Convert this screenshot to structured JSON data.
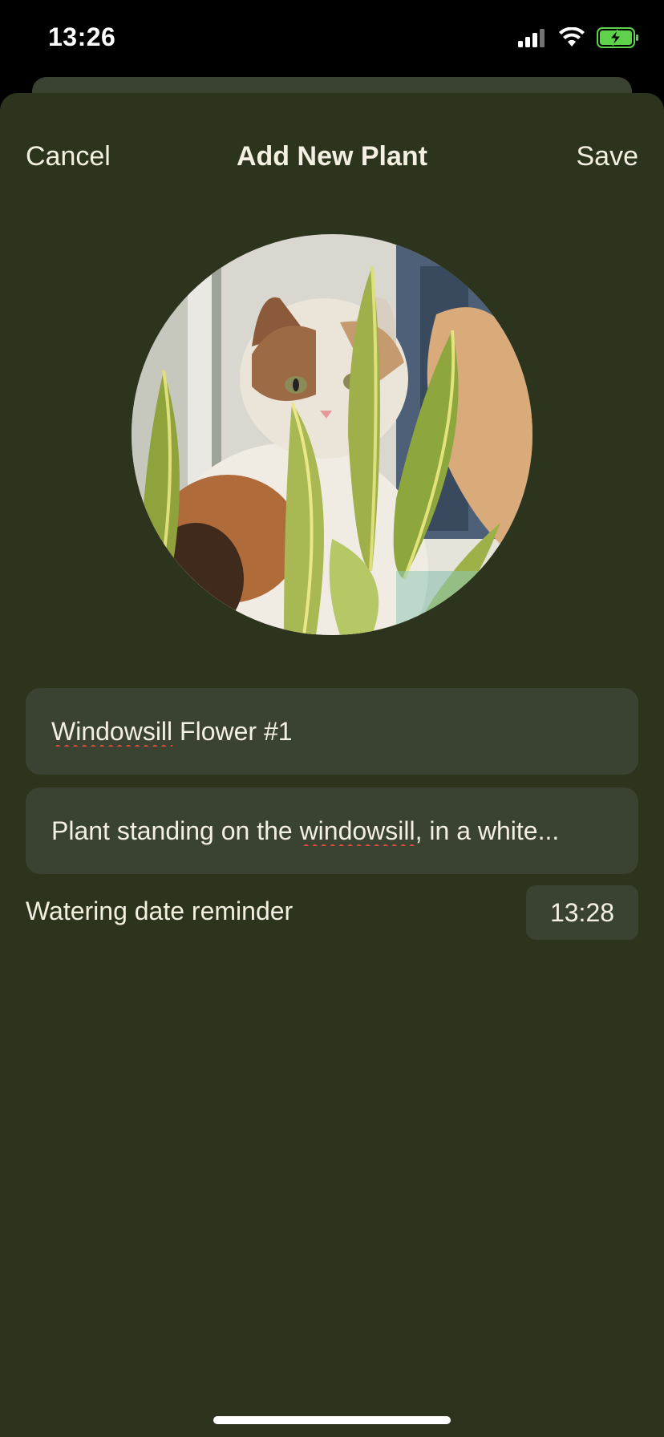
{
  "status_bar": {
    "time": "13:26",
    "icons": [
      "cellular-signal-icon",
      "wifi-icon",
      "battery-charging-icon"
    ]
  },
  "nav": {
    "cancel_label": "Cancel",
    "title": "Add New Plant",
    "save_label": "Save"
  },
  "photo": {
    "description_icon": "plant-photo"
  },
  "form": {
    "name_value": "Windowsill Flower #1",
    "name_parts": [
      "Windowsill",
      " Flower #1"
    ],
    "description_parts": [
      "Plant standing on the ",
      "windowsill",
      ", in a white..."
    ],
    "reminder_label": "Watering date reminder",
    "reminder_time": "13:28"
  },
  "colors": {
    "background": "#2c341e",
    "field": "#3a4332",
    "text": "#f3efe3",
    "spellcheck": "#e04b3a"
  }
}
